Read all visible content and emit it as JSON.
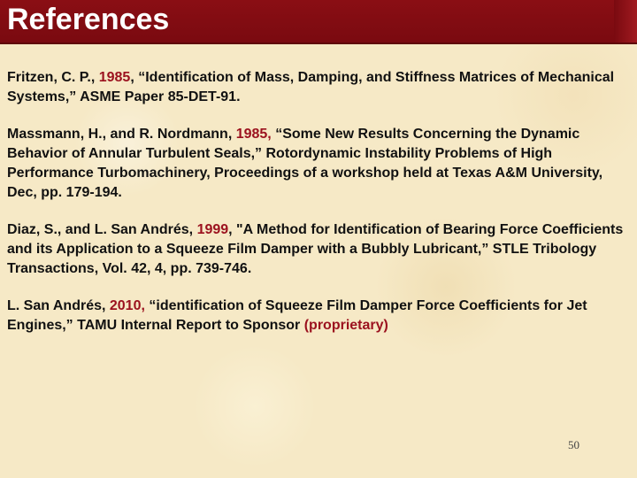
{
  "title": "References",
  "references": [
    {
      "pre": "Fritzen, C. P., ",
      "year": "1985",
      "post": ", “Identification of Mass, Damping, and Stiffness Matrices of Mechanical Systems,” ASME Paper 85-DET-91."
    },
    {
      "pre": "Massmann, H., and R. Nordmann, ",
      "year": "1985,",
      "post": " “Some New Results Concerning the Dynamic Behavior of Annular Turbulent Seals,” Rotordynamic Instability Problems of High Performance Turbomachinery, Proceedings of a workshop held at Texas A&M University, Dec, pp. 179-194."
    },
    {
      "pre": "Diaz, S., and L. San Andrés, ",
      "year": "1999",
      "post": ", \"A Method for Identification of Bearing Force Coefficients and its Application to a Squeeze Film Damper with a Bubbly Lubricant,” STLE Tribology Transactions, Vol. 42, 4, pp. 739-746."
    },
    {
      "pre": "L. San Andrés, ",
      "year": "2010,",
      "post": " “identification of  Squeeze Film Damper Force Coefficients for Jet Engines,” TAMU Internal Report to Sponsor ",
      "tag": "(proprietary)"
    }
  ],
  "page_number": "50",
  "colors": {
    "title_bar": "#7a0a10",
    "year_highlight": "#9b111e",
    "background": "#f6e9c6"
  }
}
